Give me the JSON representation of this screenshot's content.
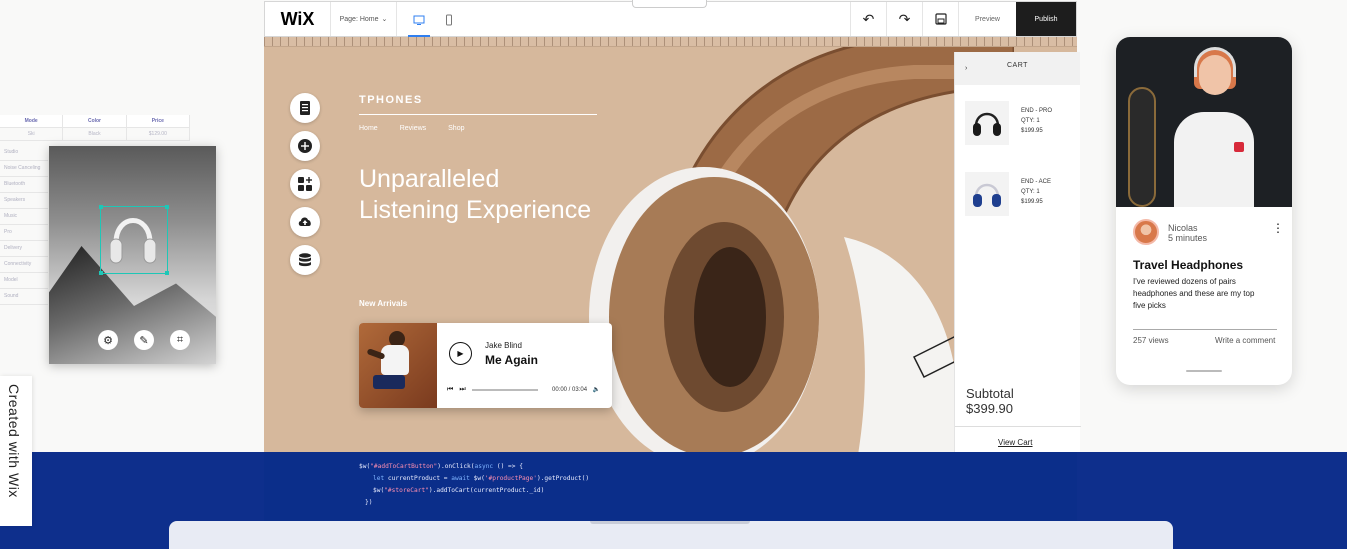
{
  "spec_table": {
    "headers": [
      "Mode",
      "Color",
      "Price"
    ],
    "row": [
      "Ski",
      "Black",
      "$129.00"
    ],
    "side_items": [
      "Studio",
      "Noise Canceling",
      "Bluetooth",
      "Speakers",
      "Music",
      "Pro",
      "Delivery",
      "Connectivity",
      "Model",
      "Sound"
    ]
  },
  "left_card": {
    "tools": [
      "settings",
      "edit",
      "crop"
    ]
  },
  "wix_tab": {
    "label": "Created with Wix"
  },
  "editor_bar": {
    "logo": "WiX",
    "page_selector": "Page: Home",
    "preview": "Preview",
    "publish": "Publish"
  },
  "site": {
    "brand": "TPHONES",
    "nav": [
      "Home",
      "Reviews",
      "Shop"
    ],
    "hero_line1": "Unparalleled",
    "hero_line2": "Listening Experience",
    "section_label": "New Arrivals"
  },
  "player": {
    "artist": "Jake Blind",
    "track": "Me Again",
    "time": "00:00 / 03:04"
  },
  "cart": {
    "title": "CART",
    "items": [
      {
        "name": "END - PRO",
        "qty": "QTY: 1",
        "price": "$199.95"
      },
      {
        "name": "END - ACE",
        "qty": "QTY: 1",
        "price": "$199.95"
      }
    ],
    "subtotal_label": "Subtotal",
    "subtotal_value": "$399.90",
    "view_cart": "View Cart"
  },
  "code": {
    "line1_a": "$w(",
    "line1_b": "\"#addToCartButton\"",
    "line1_c": ").onClick(",
    "line1_d": "async",
    "line1_e": " () => {",
    "line2_a": "let",
    "line2_b": " currentProduct = ",
    "line2_c": "await",
    "line2_d": " $w(",
    "line2_e": "'#productPage'",
    "line2_f": ").getProduct()",
    "line3_a": "$w(",
    "line3_b": "\"#storeCart\"",
    "line3_c": ").addToCart(currentProduct._id)",
    "line4": "})"
  },
  "phone": {
    "author": "Nicolas",
    "time_ago": "5 minutes",
    "post_title": "Travel Headphones",
    "post_text": "I've reviewed dozens of pairs headphones and these are my top five picks",
    "views": "257 views",
    "write_comment": "Write a comment"
  },
  "colors": {
    "canvas": "#d6b89c",
    "band": "#0e2f8c",
    "accent_blue": "#2f7ff0",
    "selection": "#1ec7b7",
    "publish_bg": "#1d1d1d"
  }
}
